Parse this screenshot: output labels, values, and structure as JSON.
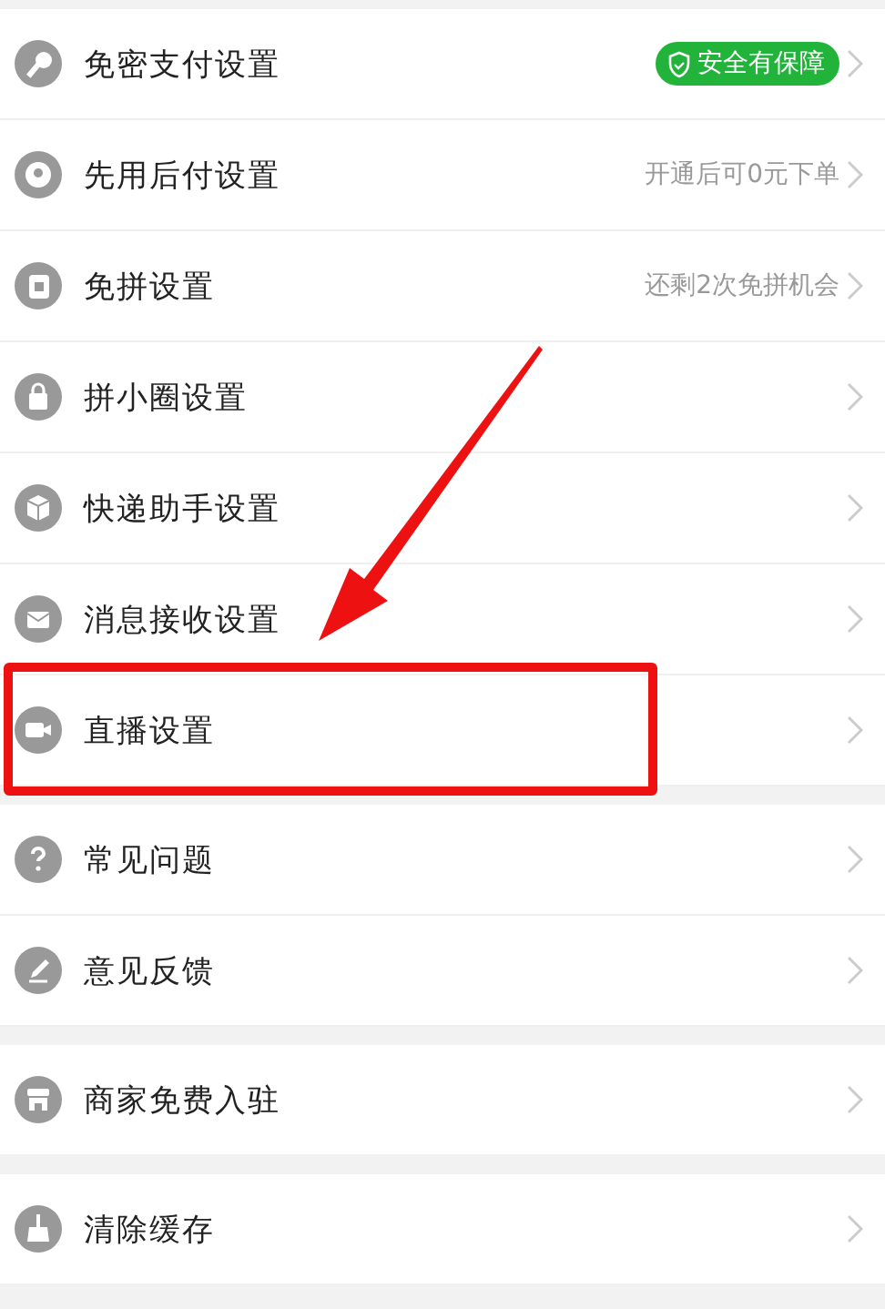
{
  "sections": [
    {
      "items": [
        {
          "label": "免密支付设置",
          "badge": "安全有保障",
          "highlighted": false
        },
        {
          "label": "先用后付设置",
          "value": "开通后可0元下单",
          "highlighted": false
        },
        {
          "label": "免拼设置",
          "value": "还剩2次免拼机会",
          "highlighted": false
        },
        {
          "label": "拼小圈设置",
          "highlighted": false
        },
        {
          "label": "快递助手设置",
          "highlighted": false
        },
        {
          "label": "消息接收设置",
          "highlighted": false
        },
        {
          "label": "直播设置",
          "highlighted": true
        }
      ]
    },
    {
      "items": [
        {
          "label": "常见问题",
          "highlighted": false
        },
        {
          "label": "意见反馈",
          "highlighted": false
        }
      ]
    },
    {
      "items": [
        {
          "label": "商家免费入驻",
          "highlighted": false
        }
      ]
    },
    {
      "items": [
        {
          "label": "清除缓存",
          "highlighted": false
        }
      ]
    }
  ]
}
